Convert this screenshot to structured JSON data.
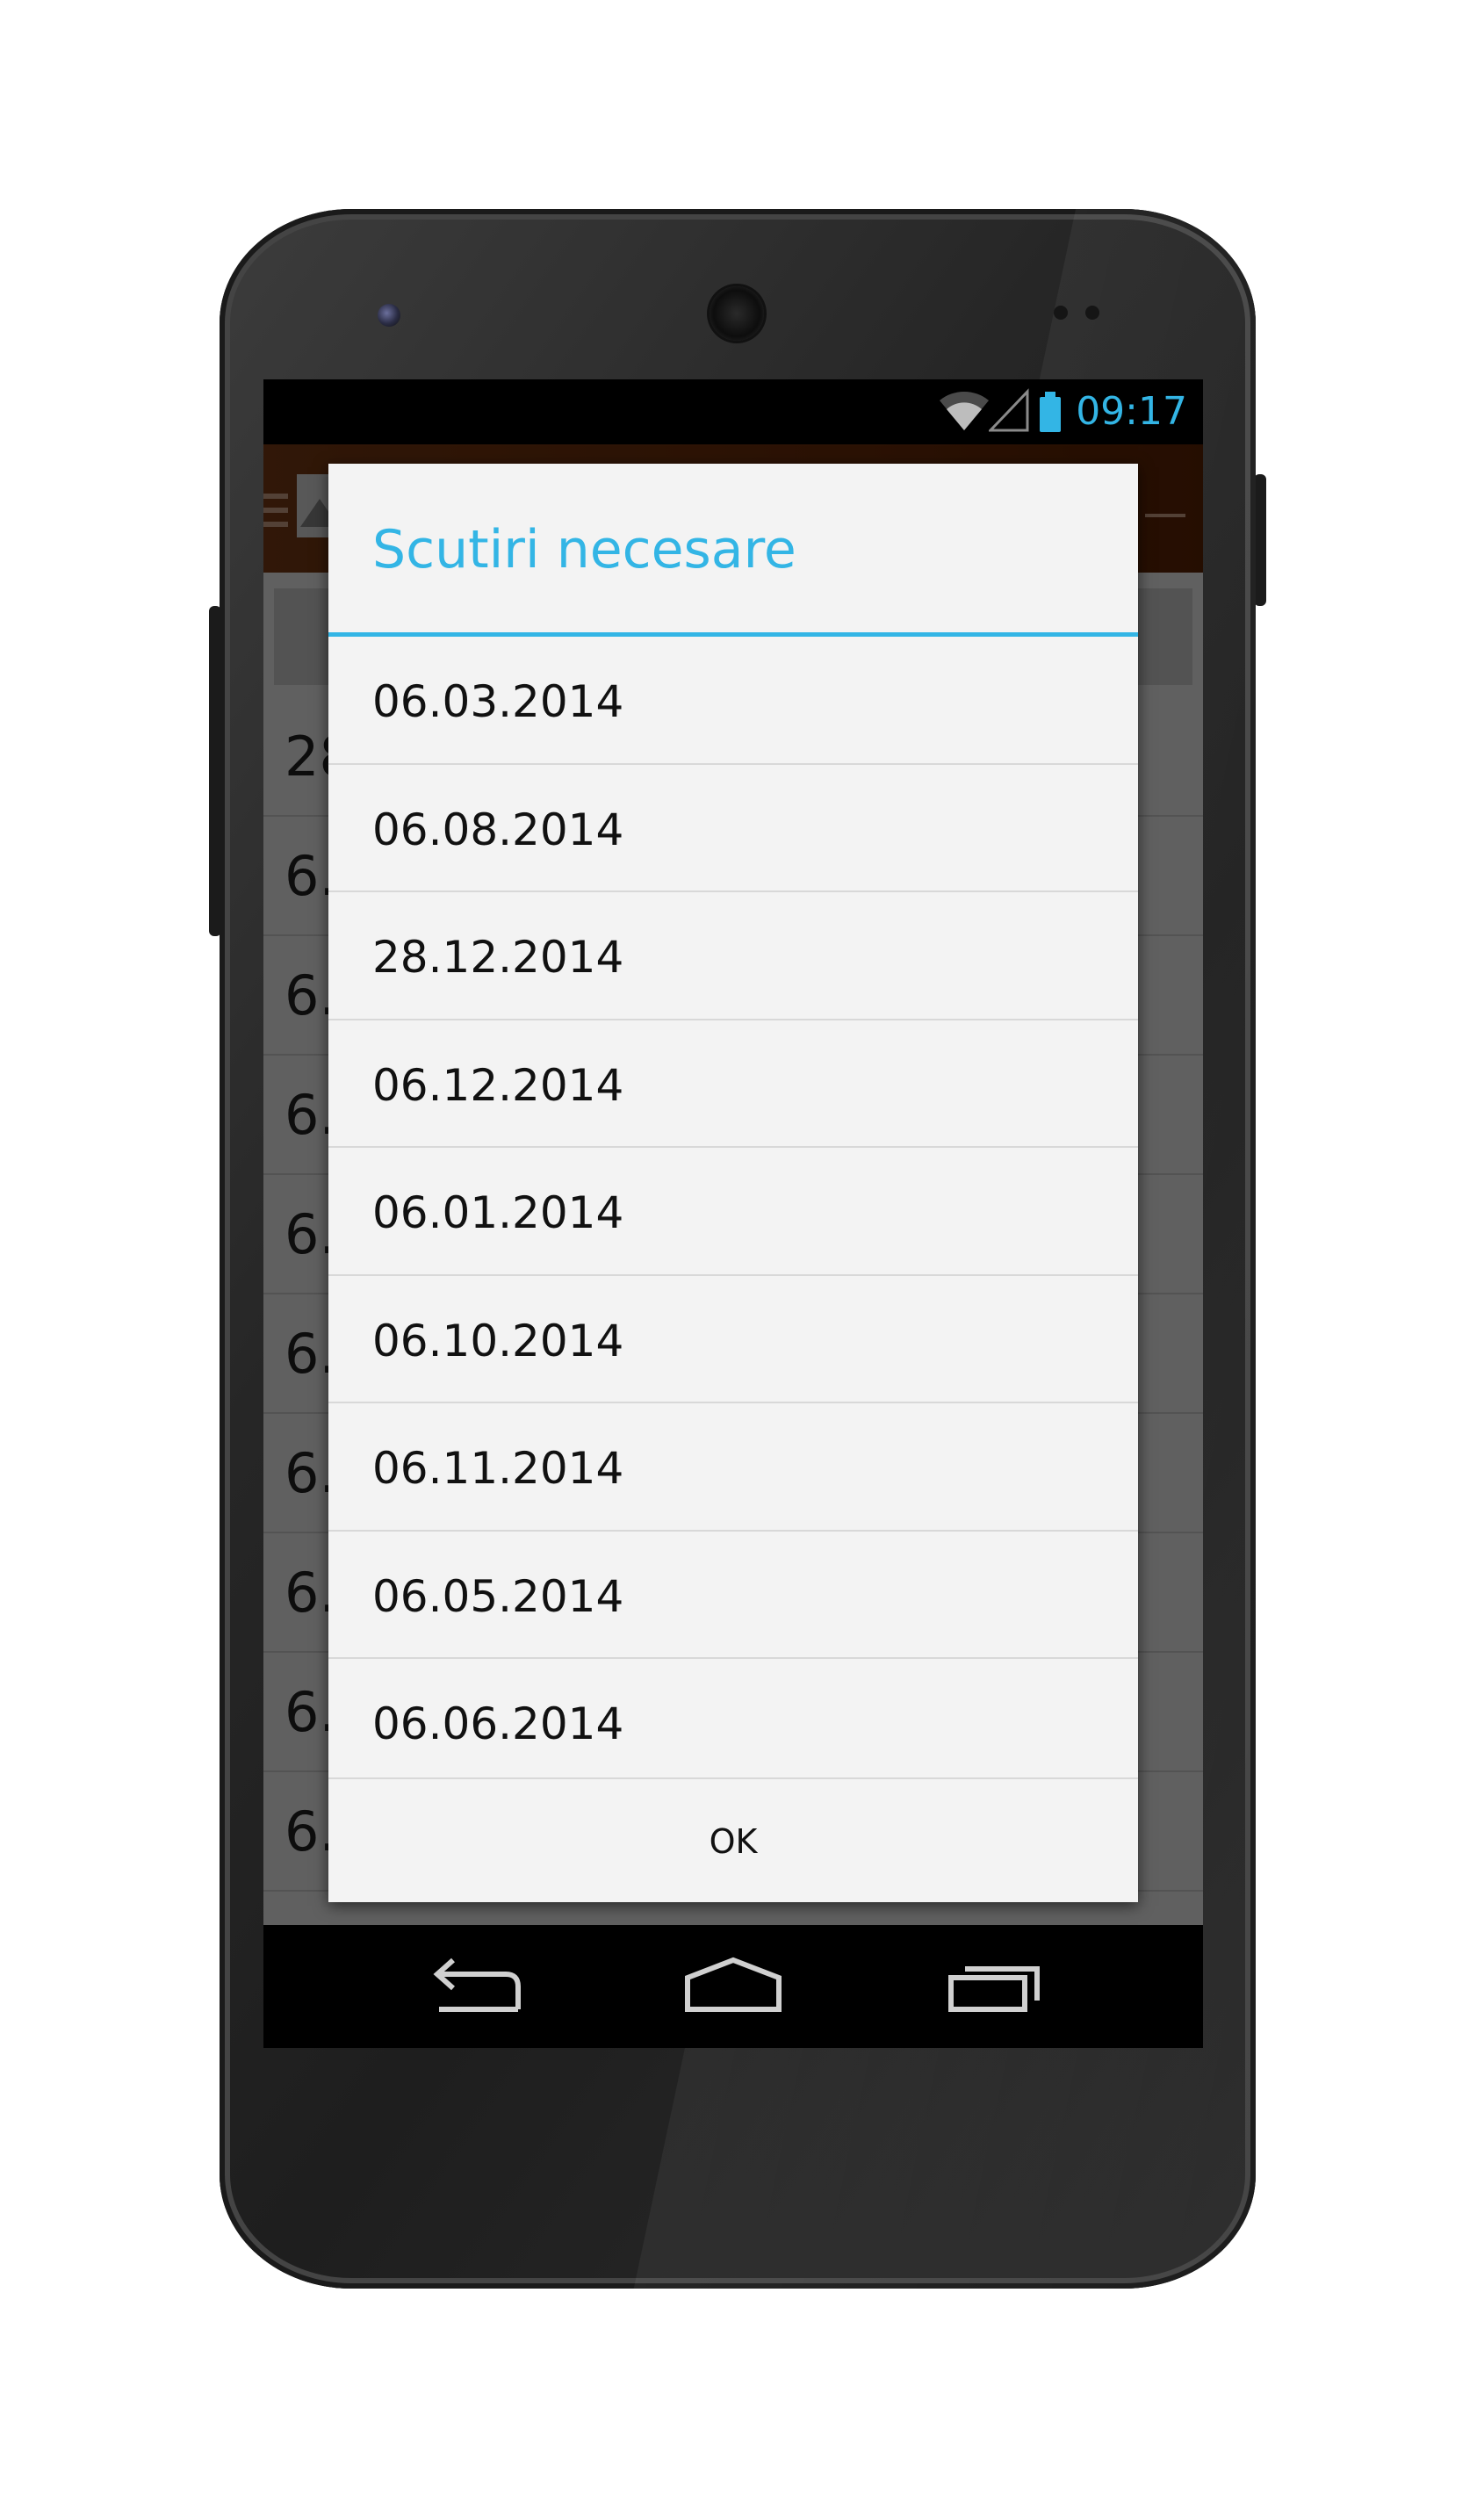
{
  "status_bar": {
    "time": "09:17",
    "icons": [
      "wifi-icon",
      "signal-icon",
      "battery-icon"
    ],
    "accent_color": "#33b5e5"
  },
  "background_app": {
    "action_bar_color": "#6d2e0c",
    "visible_rows": [
      "28",
      "6.",
      "6.",
      "6.",
      "6.",
      "6.",
      "6.",
      "6.",
      "6.",
      "6."
    ]
  },
  "dialog": {
    "title": "Scutiri necesare",
    "items": [
      "06.03.2014",
      "06.08.2014",
      "28.12.2014",
      "06.12.2014",
      "06.01.2014",
      "06.10.2014",
      "06.11.2014",
      "06.05.2014",
      "06.06.2014"
    ],
    "ok_label": "OK"
  },
  "nav_bar": {
    "buttons": [
      "back-icon",
      "home-icon",
      "recent-apps-icon"
    ]
  }
}
